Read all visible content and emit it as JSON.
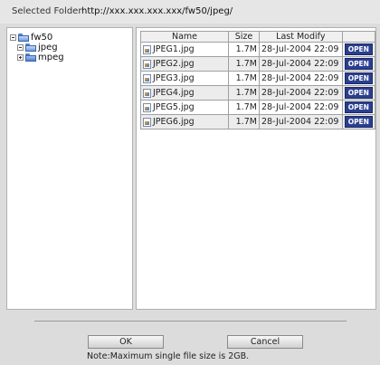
{
  "header": {
    "label": "Selected Folder",
    "path": "http://xxx.xxx.xxx.xxx/fw50/jpeg/"
  },
  "tree": {
    "root": {
      "label": "fw50",
      "state": "expanded"
    },
    "children": [
      {
        "label": "jpeg",
        "state": "expanded"
      },
      {
        "label": "mpeg",
        "state": "collapsed"
      }
    ]
  },
  "table": {
    "columns": [
      "Name",
      "Size",
      "Last Modify",
      ""
    ],
    "rows": [
      {
        "name": "JPEG1.jpg",
        "size": "1.7M",
        "modified": "28-Jul-2004 22:09",
        "action": "OPEN"
      },
      {
        "name": "JPEG2.jpg",
        "size": "1.7M",
        "modified": "28-Jul-2004 22:09",
        "action": "OPEN"
      },
      {
        "name": "JPEG3.jpg",
        "size": "1.7M",
        "modified": "28-Jul-2004 22:09",
        "action": "OPEN"
      },
      {
        "name": "JPEG4.jpg",
        "size": "1.7M",
        "modified": "28-Jul-2004 22:09",
        "action": "OPEN"
      },
      {
        "name": "JPEG5.jpg",
        "size": "1.7M",
        "modified": "28-Jul-2004 22:09",
        "action": "OPEN"
      },
      {
        "name": "JPEG6.jpg",
        "size": "1.7M",
        "modified": "28-Jul-2004 22:09",
        "action": "OPEN"
      }
    ]
  },
  "footer": {
    "ok_label": "OK",
    "cancel_label": "Cancel",
    "note": "Note:Maximum single file size is 2GB."
  },
  "colors": {
    "background": "#dcdcdc",
    "open_button": "#2b3f8f",
    "folder": "#4f7fcf"
  }
}
